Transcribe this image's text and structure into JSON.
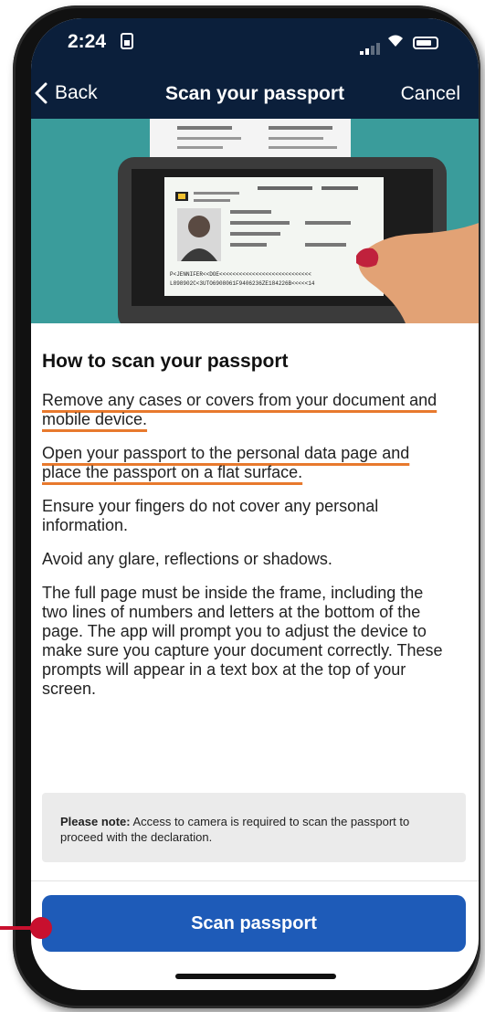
{
  "status_bar": {
    "time": "2:24"
  },
  "nav": {
    "back_label": "Back",
    "title": "Scan your passport",
    "cancel_label": "Cancel"
  },
  "illustration": {
    "mrz_line1": "P<JENNIFER<<DOE<<<<<<<<<<<<<<<<<<<<<<<<<<<<",
    "mrz_line2": "L898902C<3UTO6908061F9406236ZE184226B<<<<<14"
  },
  "instructions": {
    "heading": "How to scan your passport",
    "items": [
      "Remove any cases or covers from your document and mobile device.",
      "Open your passport to the personal data page and place the passport on a flat surface.",
      "Ensure your fingers do not cover any personal information.",
      "Avoid any glare, reflections or shadows.",
      "The full page must be inside the frame, including the two lines of numbers and letters at the bottom of the page. The app will prompt you to adjust the device to make sure you capture your document correctly. These prompts will appear in a text box at the top of your screen."
    ]
  },
  "note": {
    "label": "Please note:",
    "text": " Access to camera is required to scan the passport to proceed with the declaration."
  },
  "scan_button_label": "Scan passport",
  "colors": {
    "nav_background": "#0b1f3b",
    "hero_background": "#3a9c9b",
    "button_blue": "#1e5bb8",
    "underline_orange": "#e8792d",
    "annotation_red": "#c8102e"
  }
}
